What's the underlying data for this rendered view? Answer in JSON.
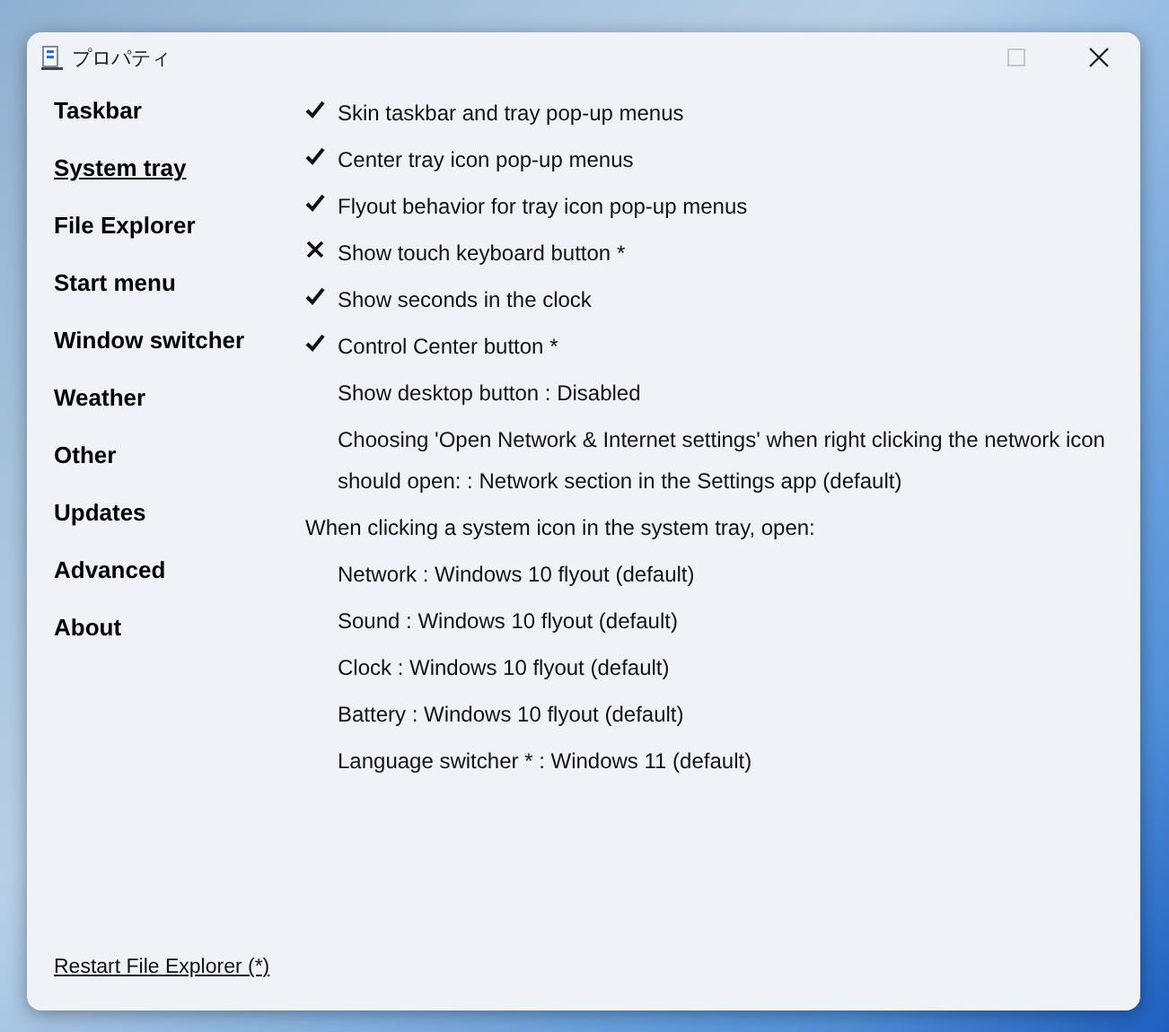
{
  "window": {
    "title": "プロパティ"
  },
  "sidebar": {
    "items": [
      {
        "label": "Taskbar",
        "selected": false
      },
      {
        "label": "System tray",
        "selected": true
      },
      {
        "label": "File Explorer",
        "selected": false
      },
      {
        "label": "Start menu",
        "selected": false
      },
      {
        "label": "Window switcher",
        "selected": false
      },
      {
        "label": "Weather",
        "selected": false
      },
      {
        "label": "Other",
        "selected": false
      },
      {
        "label": "Updates",
        "selected": false
      },
      {
        "label": "Advanced",
        "selected": false
      },
      {
        "label": "About",
        "selected": false
      }
    ]
  },
  "options": [
    {
      "kind": "toggle",
      "label": "Skin taskbar and tray pop-up menus",
      "checked": true
    },
    {
      "kind": "toggle",
      "label": "Center tray icon pop-up menus",
      "checked": true
    },
    {
      "kind": "toggle",
      "label": "Flyout behavior for tray icon pop-up menus",
      "checked": true
    },
    {
      "kind": "toggle",
      "label": "Show touch keyboard button *",
      "checked": false
    },
    {
      "kind": "toggle",
      "label": "Show seconds in the clock",
      "checked": true
    },
    {
      "kind": "toggle",
      "label": "Control Center button *",
      "checked": true
    },
    {
      "kind": "value",
      "label": "Show desktop button : Disabled"
    },
    {
      "kind": "value",
      "label": "Choosing 'Open Network & Internet settings' when right clicking the network icon should open: : Network section in the Settings app (default)"
    },
    {
      "kind": "heading",
      "label": "When clicking a system icon in the system tray, open:"
    },
    {
      "kind": "value",
      "label": "Network : Windows 10 flyout (default)"
    },
    {
      "kind": "value",
      "label": "Sound : Windows 10 flyout (default)"
    },
    {
      "kind": "value",
      "label": "Clock : Windows 10 flyout (default)"
    },
    {
      "kind": "value",
      "label": "Battery : Windows 10 flyout (default)"
    },
    {
      "kind": "value",
      "label": "Language switcher * : Windows 11 (default)"
    }
  ],
  "footer": {
    "link": "Restart File Explorer (*)"
  }
}
